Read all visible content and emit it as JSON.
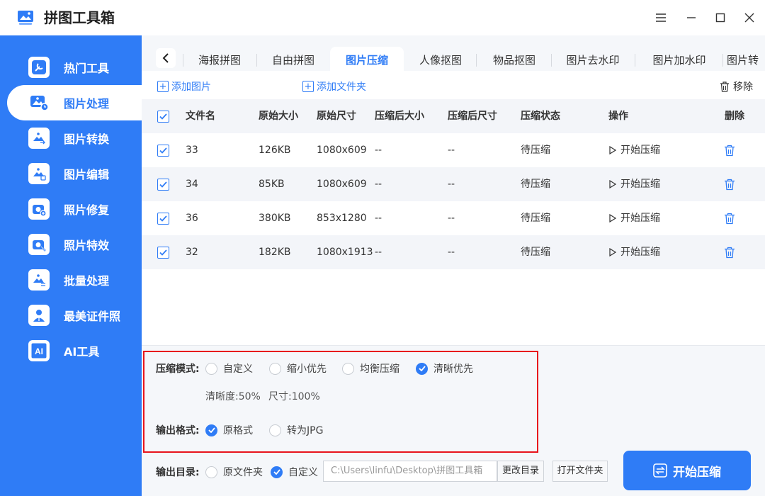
{
  "app": {
    "title": "拼图工具箱"
  },
  "sidebar": {
    "items": [
      {
        "label": "热门工具",
        "icon": "hot-tools-icon"
      },
      {
        "label": "图片处理",
        "icon": "image-process-icon",
        "active": true
      },
      {
        "label": "图片转换",
        "icon": "image-convert-icon"
      },
      {
        "label": "图片编辑",
        "icon": "image-edit-icon"
      },
      {
        "label": "照片修复",
        "icon": "photo-repair-icon"
      },
      {
        "label": "照片特效",
        "icon": "photo-effect-icon"
      },
      {
        "label": "批量处理",
        "icon": "batch-process-icon"
      },
      {
        "label": "最美证件照",
        "icon": "id-photo-icon"
      },
      {
        "label": "AI工具",
        "icon": "ai-tools-icon"
      }
    ]
  },
  "tabs": {
    "items": [
      "海报拼图",
      "自由拼图",
      "图片压缩",
      "人像抠图",
      "物品抠图",
      "图片去水印",
      "图片加水印",
      "图片转"
    ],
    "active_index": 2
  },
  "toolbar": {
    "add_image": "添加图片",
    "add_folder": "添加文件夹",
    "remove": "移除"
  },
  "table": {
    "headers": [
      "文件名",
      "原始大小",
      "原始尺寸",
      "压缩后大小",
      "压缩后尺寸",
      "压缩状态",
      "操作",
      "删除"
    ],
    "rows": [
      {
        "name": "33",
        "size": "126KB",
        "dims": "1080x609",
        "new_size": "--",
        "new_dims": "--",
        "status": "待压缩",
        "action": "开始压缩"
      },
      {
        "name": "34",
        "size": "85KB",
        "dims": "1080x609",
        "new_size": "--",
        "new_dims": "--",
        "status": "待压缩",
        "action": "开始压缩"
      },
      {
        "name": "36",
        "size": "380KB",
        "dims": "853x1280",
        "new_size": "--",
        "new_dims": "--",
        "status": "待压缩",
        "action": "开始压缩"
      },
      {
        "name": "32",
        "size": "182KB",
        "dims": "1080x1913",
        "new_size": "--",
        "new_dims": "--",
        "status": "待压缩",
        "action": "开始压缩"
      }
    ]
  },
  "settings": {
    "mode_label": "压缩模式:",
    "modes": [
      "自定义",
      "缩小优先",
      "均衡压缩",
      "清晰优先"
    ],
    "mode_selected": 3,
    "clarity": "清晰度:50%",
    "size_pct": "尺寸:100%",
    "format_label": "输出格式:",
    "formats": [
      "原格式",
      "转为JPG"
    ],
    "format_selected": 0,
    "output_label": "输出目录:",
    "outputs": [
      "原文件夹",
      "自定义"
    ],
    "output_selected": 1,
    "path": "C:\\Users\\linfu\\Desktop\\拼图工具箱",
    "change_dir": "更改目录",
    "open_folder": "打开文件夹",
    "start": "开始压缩"
  },
  "colors": {
    "accent": "#2f7cf6",
    "highlight_box": "#e8141c"
  }
}
